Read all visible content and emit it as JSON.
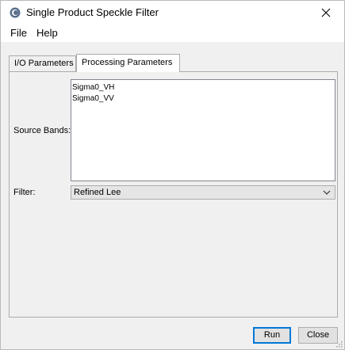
{
  "window": {
    "title": "Single Product Speckle Filter",
    "close_glyph": "✕"
  },
  "menu": {
    "items": [
      {
        "label": "File"
      },
      {
        "label": "Help"
      }
    ]
  },
  "tabs": [
    {
      "label": "I/O Parameters",
      "active": false
    },
    {
      "label": "Processing Parameters",
      "active": true
    }
  ],
  "processing": {
    "source_bands_label": "Source Bands:",
    "source_bands": [
      "Sigma0_VH",
      "Sigma0_VV"
    ],
    "filter_label": "Filter:",
    "filter_value": "Refined Lee"
  },
  "buttons": {
    "run": "Run",
    "close": "Close"
  },
  "icons": {
    "app": "snap-logo-icon",
    "close": "close-icon",
    "dropdown": "chevron-down-icon",
    "grip": "resize-grip-icon"
  },
  "colors": {
    "default_button_border": "#0078d7",
    "titlebar": "#ffffff",
    "dialog_background": "#f0f0f0"
  }
}
